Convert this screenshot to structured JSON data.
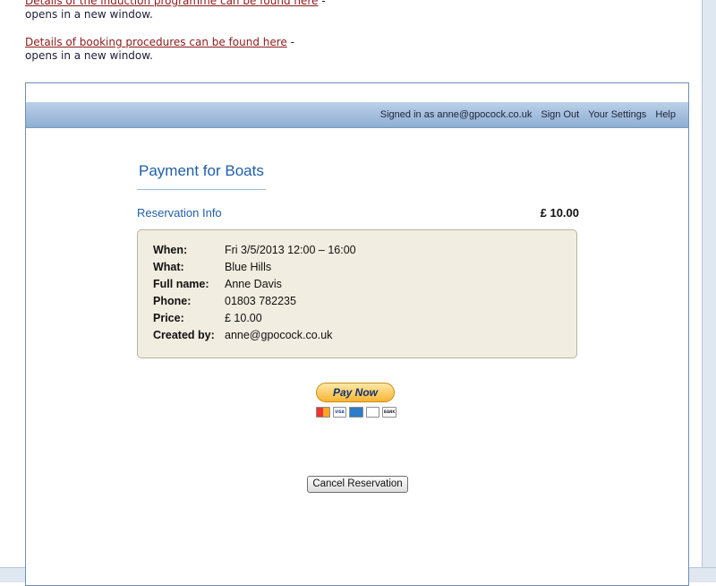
{
  "top_links": [
    {
      "link_text": "Details of the induction programme can be found here",
      "suffix": " - opens in a new window."
    },
    {
      "link_text": "Details of booking procedures can be found here",
      "suffix": " - opens in a new window."
    }
  ],
  "topbar": {
    "signed_in_text": "Signed in as anne@gpocock.co.uk",
    "sign_out": "Sign Out",
    "settings": "Your Settings",
    "help": "Help"
  },
  "page": {
    "title": "Payment for Boats",
    "section_title": "Reservation Info",
    "total": "£ 10.00"
  },
  "reservation": {
    "when_label": "When:",
    "when_value": "Fri 3/5/2013 12:00 – 16:00",
    "what_label": "What:",
    "what_value": "Blue Hills",
    "name_label": "Full name:",
    "name_value": "Anne Davis",
    "phone_label": "Phone:",
    "phone_value": "01803 782235",
    "price_label": "Price:",
    "price_value": "£ 10.00",
    "created_label": "Created by:",
    "created_value": "anne@gpocock.co.uk"
  },
  "payment": {
    "paypal_label": "Pay Now",
    "card_icons": [
      "mastercard-icon",
      "visa-icon",
      "amex-icon",
      "discover-icon",
      "bank-icon"
    ],
    "card_text": {
      "visa": "VISA",
      "bank": "BANK"
    }
  },
  "cancel_label": "Cancel Reservation",
  "colors": {
    "accent": "#1f5fa8",
    "link": "#8b1a1a",
    "box_bg": "#f1ede0"
  }
}
